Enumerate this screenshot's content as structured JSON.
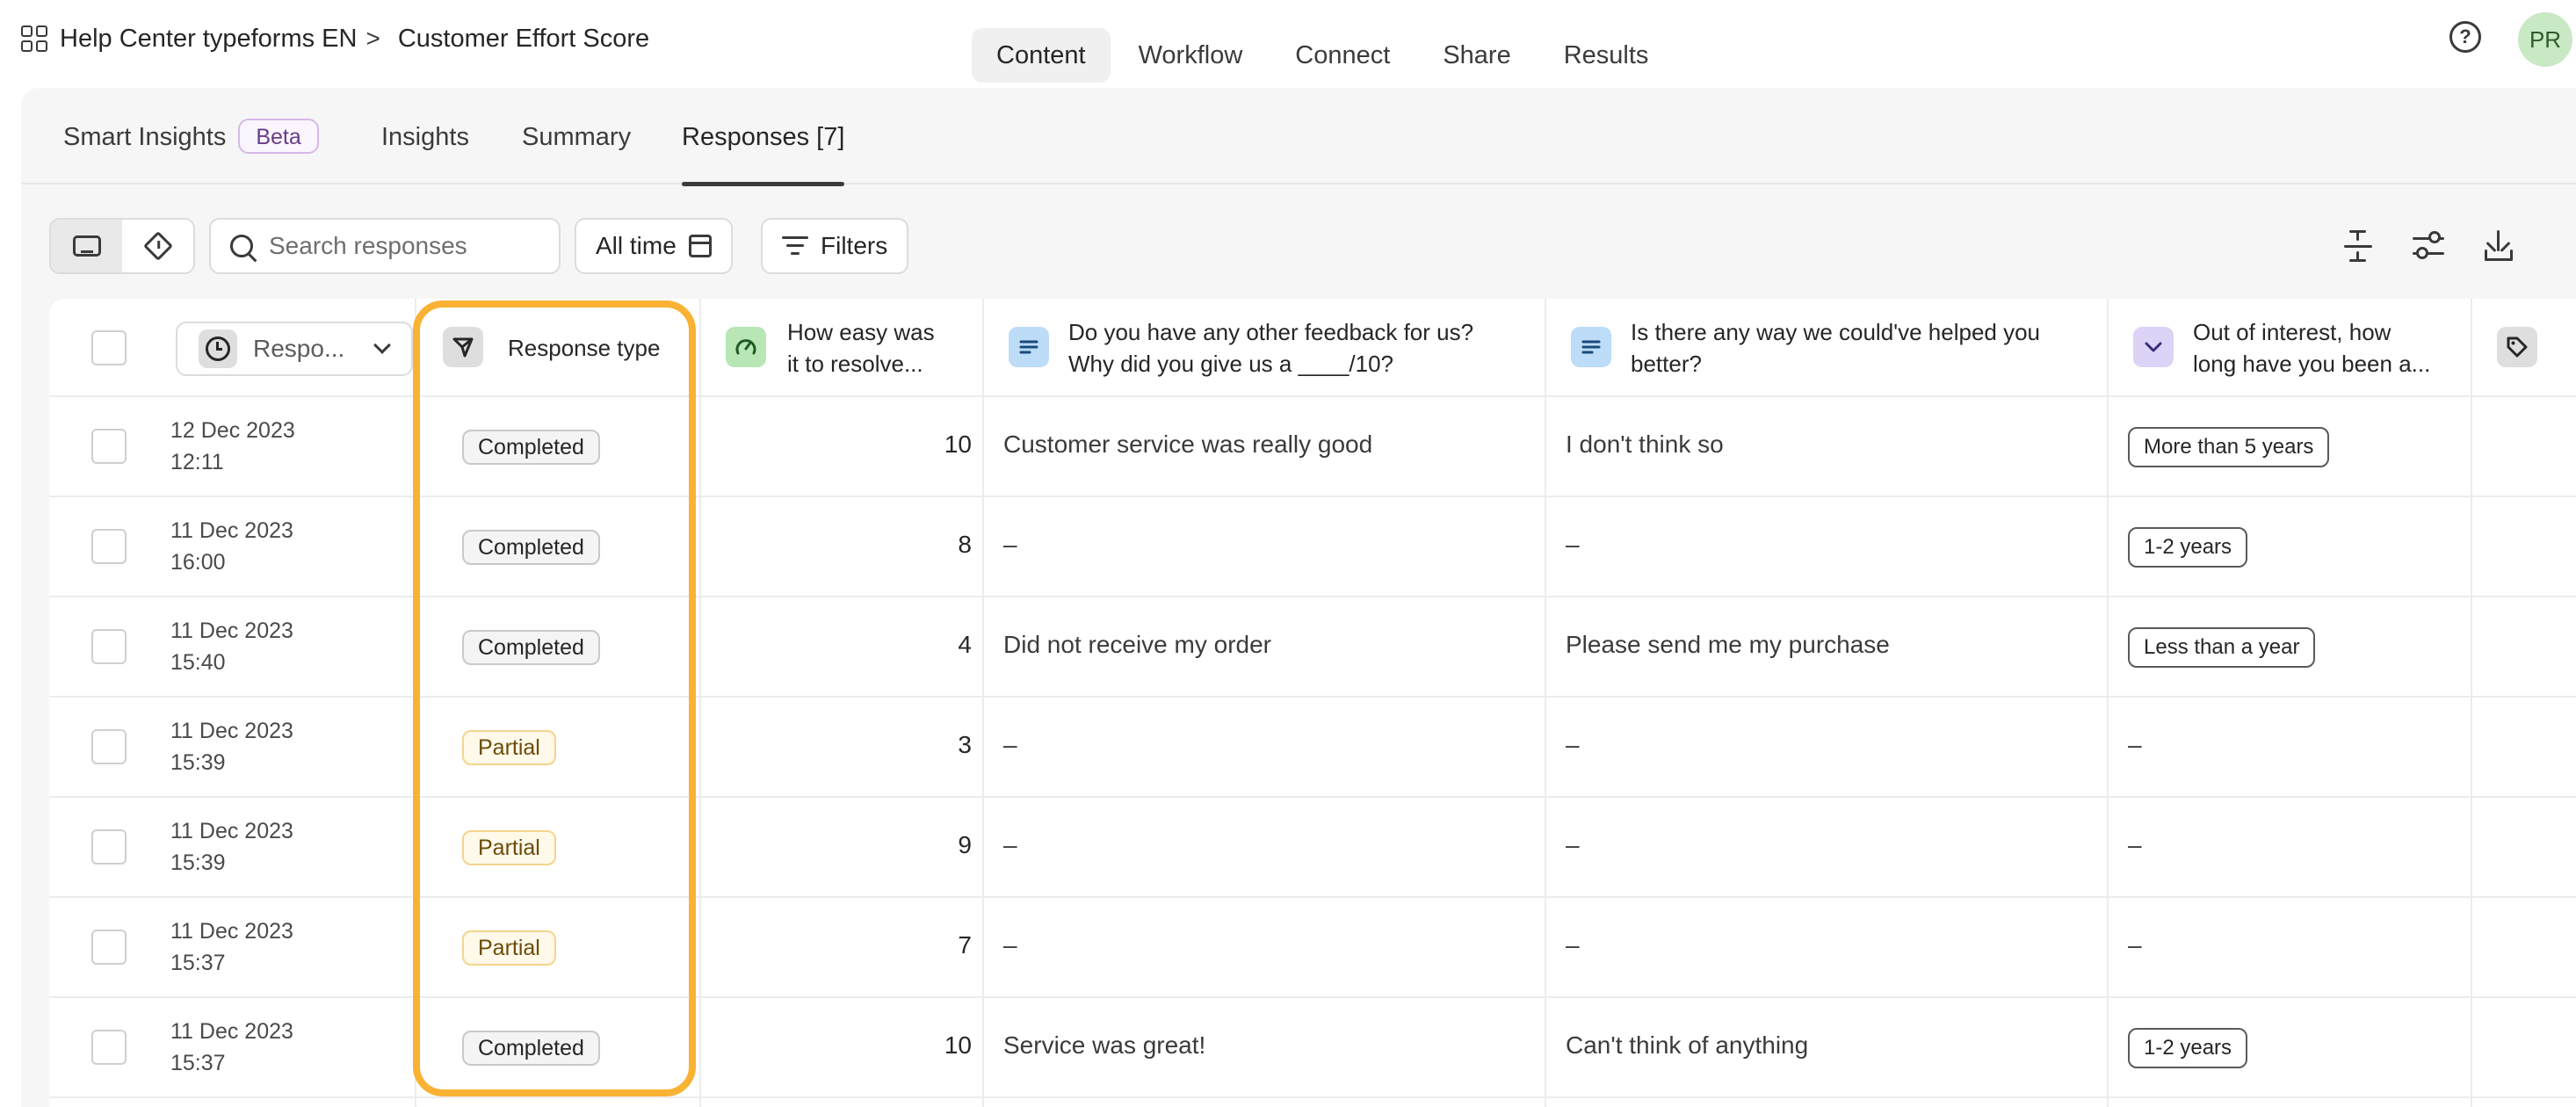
{
  "breadcrumb": {
    "workspace": "Help Center typeforms EN",
    "separator": ">",
    "form": "Customer Effort Score"
  },
  "main_nav": [
    "Content",
    "Workflow",
    "Connect",
    "Share",
    "Results"
  ],
  "user": {
    "initials": "PR"
  },
  "subtabs": {
    "smart_insights": "Smart Insights",
    "beta": "Beta",
    "insights": "Insights",
    "summary": "Summary",
    "responses": "Responses [7]"
  },
  "toolbar": {
    "search_placeholder": "Search responses",
    "date_range": "All time",
    "filters": "Filters"
  },
  "columns": {
    "submitted": "Respo...",
    "response_type": "Response type",
    "q1": [
      "How easy was",
      "it to resolve..."
    ],
    "q2": [
      "Do you have any other feedback for us?",
      "Why did you give us a ____/10?"
    ],
    "q3": [
      "Is there any way we could've helped you",
      "better?"
    ],
    "q4": [
      "Out of interest, how",
      "long have you been a..."
    ]
  },
  "rows": [
    {
      "date": "12 Dec 2023",
      "time": "12:11",
      "type": "Completed",
      "score": "10",
      "feedback": "Customer service was really good",
      "help": "I don't think so",
      "tenure": "More than 5 years"
    },
    {
      "date": "11 Dec 2023",
      "time": "16:00",
      "type": "Completed",
      "score": "8",
      "feedback": "–",
      "help": "–",
      "tenure": "1-2 years"
    },
    {
      "date": "11 Dec 2023",
      "time": "15:40",
      "type": "Completed",
      "score": "4",
      "feedback": "Did not receive my order",
      "help": "Please send me my purchase",
      "tenure": "Less than a year"
    },
    {
      "date": "11 Dec 2023",
      "time": "15:39",
      "type": "Partial",
      "score": "3",
      "feedback": "–",
      "help": "–",
      "tenure": "–"
    },
    {
      "date": "11 Dec 2023",
      "time": "15:39",
      "type": "Partial",
      "score": "9",
      "feedback": "–",
      "help": "–",
      "tenure": "–"
    },
    {
      "date": "11 Dec 2023",
      "time": "15:37",
      "type": "Partial",
      "score": "7",
      "feedback": "–",
      "help": "–",
      "tenure": "–"
    },
    {
      "date": "11 Dec 2023",
      "time": "15:37",
      "type": "Completed",
      "score": "10",
      "feedback": "Service was great!",
      "help": "Can't think of anything",
      "tenure": "1-2 years"
    }
  ],
  "colors": {
    "highlight": "#f9b233",
    "partial_bg": "#fff9ea",
    "avatar_bg": "#c9e8c4"
  }
}
